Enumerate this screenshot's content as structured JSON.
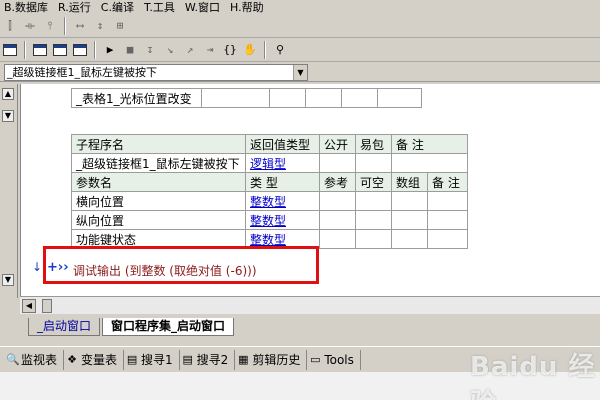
{
  "menubar": {
    "items": [
      "B.数据库",
      "R.运行",
      "C.编译",
      "T.工具",
      "W.窗口",
      "H.帮助"
    ]
  },
  "toolbar_icons": [
    "align-left-icon",
    "align-center-icon",
    "align-right-icon",
    "width-icon",
    "height-icon",
    "same-size-icon",
    "print-icon",
    "layout1-icon",
    "layout2-icon",
    "layout3-icon",
    "run-icon",
    "stop-icon",
    "step-icon",
    "step-into-icon",
    "step-out-icon",
    "run-to-icon",
    "breakpoint-icon",
    "hand-icon",
    "find-icon"
  ],
  "dropdown": {
    "value": "_超级链接框1_鼠标左键被按下"
  },
  "table_top": {
    "rows": [
      [
        "_表格1_光标位置改变",
        "",
        "",
        "",
        "",
        ""
      ]
    ]
  },
  "main_table": {
    "header1": [
      "子程序名",
      "返回值类型",
      "公开",
      "易包",
      "备 注"
    ],
    "sub_row": {
      "name": "_超级链接框1_鼠标左键被按下",
      "return_type": "逻辑型"
    },
    "header2": [
      "参数名",
      "类 型",
      "参考",
      "可空",
      "数组",
      "备 注"
    ],
    "params": [
      {
        "name": "横向位置",
        "type": "整数型"
      },
      {
        "name": "纵向位置",
        "type": "整数型"
      },
      {
        "name": "功能键状态",
        "type": "整数型"
      }
    ]
  },
  "code": {
    "line": "调试输出 (到整数 (取绝对值 (-6)))"
  },
  "tabs": [
    "_启动窗口",
    "窗口程序集_启动窗口"
  ],
  "dock": [
    {
      "label": "监视表",
      "icon": "search-icon"
    },
    {
      "label": "变量表",
      "icon": "variables-icon"
    },
    {
      "label": "搜寻1",
      "icon": "search1-icon"
    },
    {
      "label": "搜寻2",
      "icon": "search2-icon"
    },
    {
      "label": "剪辑历史",
      "icon": "clipboard-icon"
    },
    {
      "label": "Tools",
      "icon": "tools-icon"
    }
  ],
  "watermark": "Baidu 经验"
}
